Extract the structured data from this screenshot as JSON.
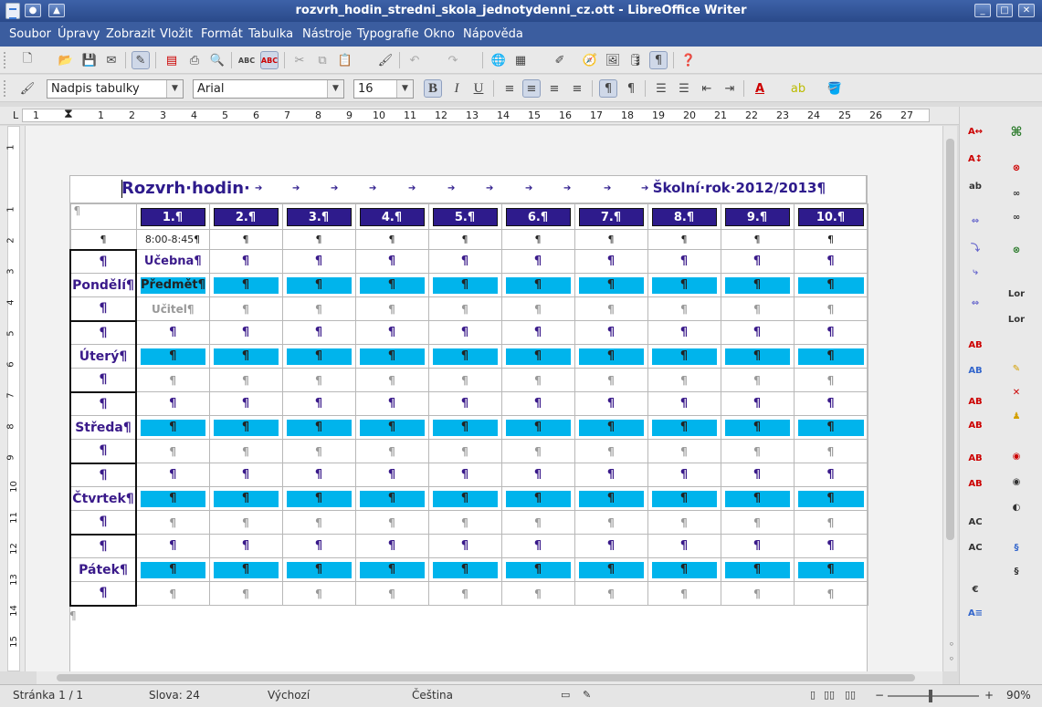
{
  "window": {
    "title": "rozvrh_hodin_stredni_skola_jednotydenni_cz.ott - LibreOffice Writer"
  },
  "menu": [
    "Soubor",
    "Úpravy",
    "Zobrazit",
    "Vložit",
    "Formát",
    "Tabulka",
    "Nástroje",
    "Typografie",
    "Okno",
    "Nápověda"
  ],
  "format_bar": {
    "style": "Nadpis tabulky",
    "font": "Arial",
    "size": "16"
  },
  "ruler": {
    "h_numbers": [
      "1",
      "1",
      "2",
      "3",
      "4",
      "5",
      "6",
      "7",
      "8",
      "9",
      "10",
      "11",
      "12",
      "13",
      "14",
      "15",
      "16",
      "17",
      "18",
      "19",
      "20",
      "21",
      "22",
      "23",
      "24",
      "25",
      "26",
      "27"
    ],
    "v_numbers": [
      "1",
      "1",
      "2",
      "3",
      "4",
      "5",
      "6",
      "7",
      "8",
      "9",
      "10",
      "11",
      "12",
      "13",
      "14",
      "15"
    ]
  },
  "document": {
    "title_left": "Rozvrh·hodin·",
    "title_right": "Školní·rok·2012/2013¶",
    "pilcrow": "¶",
    "periods": [
      "1.¶",
      "2.¶",
      "3.¶",
      "4.¶",
      "5.¶",
      "6.¶",
      "7.¶",
      "8.¶",
      "9.¶",
      "10.¶"
    ],
    "first_time": "8:00-8:45¶",
    "row_labels": {
      "room": "Učebna¶",
      "subject": "Předmět¶",
      "teacher": "Učitel¶"
    },
    "days": [
      "Pondělí¶",
      "Úterý¶",
      "Středa¶",
      "Čtvrtek¶",
      "Pátek¶"
    ]
  },
  "status": {
    "page": "Stránka 1 / 1",
    "words": "Slova: 24",
    "style": "Výchozí",
    "language": "Čeština",
    "zoom": "90%"
  },
  "colors": {
    "title_bar": "#3b5d9f",
    "header_cell": "#2e1b8c",
    "subject_cell": "#00b4ec"
  }
}
